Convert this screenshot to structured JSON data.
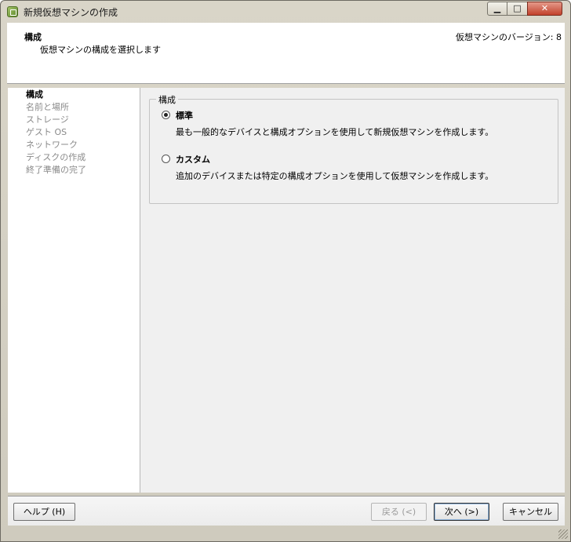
{
  "window": {
    "title": "新規仮想マシンの作成"
  },
  "header": {
    "title": "構成",
    "subtitle": "仮想マシンの構成を選択します",
    "version": "仮想マシンのバージョン: 8"
  },
  "steps": [
    {
      "label": "構成",
      "active": true
    },
    {
      "label": "名前と場所",
      "active": false
    },
    {
      "label": "ストレージ",
      "active": false
    },
    {
      "label": "ゲスト OS",
      "active": false
    },
    {
      "label": "ネットワーク",
      "active": false
    },
    {
      "label": "ディスクの作成",
      "active": false
    },
    {
      "label": "終了準備の完了",
      "active": false
    }
  ],
  "config": {
    "group_title": "構成",
    "options": [
      {
        "label": "標準",
        "description": "最も一般的なデバイスと構成オプションを使用して新規仮想マシンを作成します。",
        "selected": true
      },
      {
        "label": "カスタム",
        "description": "追加のデバイスまたは特定の構成オプションを使用して仮想マシンを作成します。",
        "selected": false
      }
    ]
  },
  "buttons": {
    "help": "ヘルプ (H)",
    "back": "戻る (<)",
    "next": "次へ (>)",
    "cancel": "キャンセル"
  }
}
